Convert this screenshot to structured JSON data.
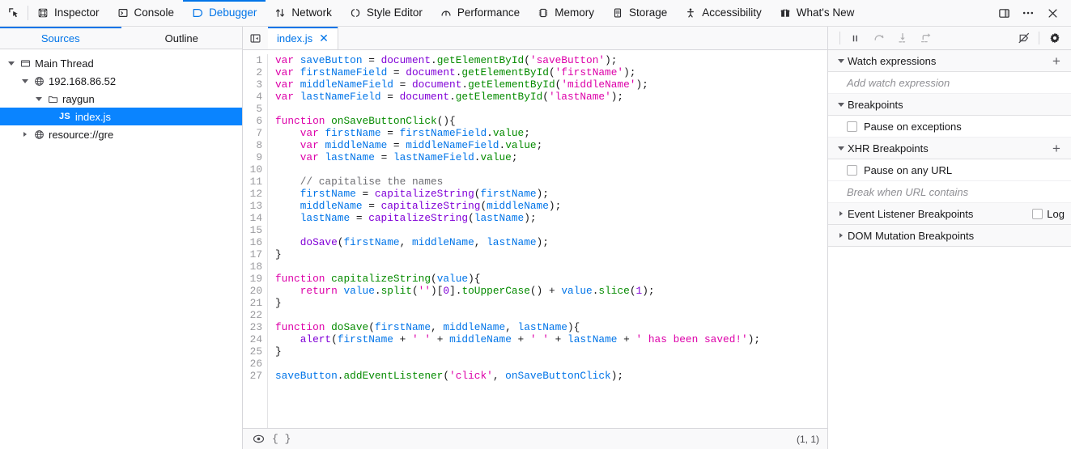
{
  "toolbar": {
    "picker_icon": "element-picker-icon",
    "tabs": [
      {
        "label": "Inspector",
        "icon": "inspector-icon",
        "active": false
      },
      {
        "label": "Console",
        "icon": "console-icon",
        "active": false
      },
      {
        "label": "Debugger",
        "icon": "debugger-icon",
        "active": true
      },
      {
        "label": "Network",
        "icon": "network-icon",
        "active": false
      },
      {
        "label": "Style Editor",
        "icon": "style-editor-icon",
        "active": false
      },
      {
        "label": "Performance",
        "icon": "performance-icon",
        "active": false
      },
      {
        "label": "Memory",
        "icon": "memory-icon",
        "active": false
      },
      {
        "label": "Storage",
        "icon": "storage-icon",
        "active": false
      },
      {
        "label": "Accessibility",
        "icon": "accessibility-icon",
        "active": false
      },
      {
        "label": "What's New",
        "icon": "whats-new-gift-icon",
        "active": false
      }
    ],
    "right_buttons": [
      {
        "name": "dock-to-side-icon"
      },
      {
        "name": "meatball-menu-icon"
      },
      {
        "name": "close-devtools-icon"
      }
    ],
    "accent_color": "#0074e8",
    "background": "#f9f9fa"
  },
  "sources": {
    "tabs": [
      {
        "label": "Sources",
        "active": true
      },
      {
        "label": "Outline",
        "active": false
      }
    ],
    "tree": [
      {
        "label": "Main Thread",
        "icon": "thread-icon",
        "depth": 0,
        "twisty": "open",
        "selected": false
      },
      {
        "label": "192.168.86.52",
        "icon": "globe-icon",
        "depth": 1,
        "twisty": "open",
        "selected": false
      },
      {
        "label": "raygun",
        "icon": "folder-icon",
        "depth": 2,
        "twisty": "open",
        "selected": false
      },
      {
        "label": "index.js",
        "icon": "js-file-icon",
        "depth": 3,
        "twisty": "none",
        "selected": true,
        "badge": "JS"
      },
      {
        "label": "resource://gre",
        "icon": "globe-icon",
        "depth": 1,
        "twisty": "closed",
        "selected": false
      }
    ],
    "selected_color": "#0a84ff"
  },
  "editor": {
    "tabbar_button": "show-sources-pane-icon",
    "file_tab": {
      "label": "index.js",
      "close_label": "✕",
      "active": true
    },
    "cursor_position": "(1, 1)",
    "prettyprint_label": "{ }",
    "eye_icon": "watch-source-icon",
    "lines": [
      {
        "n": 1,
        "tokens": [
          {
            "t": "var",
            "c": "t-kw"
          },
          {
            "t": " "
          },
          {
            "t": "saveButton",
            "c": "t-var"
          },
          {
            "t": " = "
          },
          {
            "t": "document",
            "c": "t-obj"
          },
          {
            "t": "."
          },
          {
            "t": "getElementById",
            "c": "t-prop"
          },
          {
            "t": "("
          },
          {
            "t": "'saveButton'",
            "c": "t-str"
          },
          {
            "t": ");"
          }
        ]
      },
      {
        "n": 2,
        "tokens": [
          {
            "t": "var",
            "c": "t-kw"
          },
          {
            "t": " "
          },
          {
            "t": "firstNameField",
            "c": "t-var"
          },
          {
            "t": " = "
          },
          {
            "t": "document",
            "c": "t-obj"
          },
          {
            "t": "."
          },
          {
            "t": "getElementById",
            "c": "t-prop"
          },
          {
            "t": "("
          },
          {
            "t": "'firstName'",
            "c": "t-str"
          },
          {
            "t": ");"
          }
        ]
      },
      {
        "n": 3,
        "tokens": [
          {
            "t": "var",
            "c": "t-kw"
          },
          {
            "t": " "
          },
          {
            "t": "middleNameField",
            "c": "t-var"
          },
          {
            "t": " = "
          },
          {
            "t": "document",
            "c": "t-obj"
          },
          {
            "t": "."
          },
          {
            "t": "getElementById",
            "c": "t-prop"
          },
          {
            "t": "("
          },
          {
            "t": "'middleName'",
            "c": "t-str"
          },
          {
            "t": ");"
          }
        ]
      },
      {
        "n": 4,
        "tokens": [
          {
            "t": "var",
            "c": "t-kw"
          },
          {
            "t": " "
          },
          {
            "t": "lastNameField",
            "c": "t-var"
          },
          {
            "t": " = "
          },
          {
            "t": "document",
            "c": "t-obj"
          },
          {
            "t": "."
          },
          {
            "t": "getElementById",
            "c": "t-prop"
          },
          {
            "t": "("
          },
          {
            "t": "'lastName'",
            "c": "t-str"
          },
          {
            "t": ");"
          }
        ]
      },
      {
        "n": 5,
        "tokens": []
      },
      {
        "n": 6,
        "tokens": [
          {
            "t": "function",
            "c": "t-kw"
          },
          {
            "t": " "
          },
          {
            "t": "onSaveButtonClick",
            "c": "t-prop"
          },
          {
            "t": "(){"
          }
        ]
      },
      {
        "n": 7,
        "tokens": [
          {
            "t": "    "
          },
          {
            "t": "var",
            "c": "t-kw"
          },
          {
            "t": " "
          },
          {
            "t": "firstName",
            "c": "t-var"
          },
          {
            "t": " = "
          },
          {
            "t": "firstNameField",
            "c": "t-var"
          },
          {
            "t": "."
          },
          {
            "t": "value",
            "c": "t-prop"
          },
          {
            "t": ";"
          }
        ]
      },
      {
        "n": 8,
        "tokens": [
          {
            "t": "    "
          },
          {
            "t": "var",
            "c": "t-kw"
          },
          {
            "t": " "
          },
          {
            "t": "middleName",
            "c": "t-var"
          },
          {
            "t": " = "
          },
          {
            "t": "middleNameField",
            "c": "t-var"
          },
          {
            "t": "."
          },
          {
            "t": "value",
            "c": "t-prop"
          },
          {
            "t": ";"
          }
        ]
      },
      {
        "n": 9,
        "tokens": [
          {
            "t": "    "
          },
          {
            "t": "var",
            "c": "t-kw"
          },
          {
            "t": " "
          },
          {
            "t": "lastName",
            "c": "t-var"
          },
          {
            "t": " = "
          },
          {
            "t": "lastNameField",
            "c": "t-var"
          },
          {
            "t": "."
          },
          {
            "t": "value",
            "c": "t-prop"
          },
          {
            "t": ";"
          }
        ]
      },
      {
        "n": 10,
        "tokens": []
      },
      {
        "n": 11,
        "tokens": [
          {
            "t": "    "
          },
          {
            "t": "// capitalise the names",
            "c": "t-cmt"
          }
        ]
      },
      {
        "n": 12,
        "tokens": [
          {
            "t": "    "
          },
          {
            "t": "firstName",
            "c": "t-var"
          },
          {
            "t": " = "
          },
          {
            "t": "capitalizeString",
            "c": "t-obj"
          },
          {
            "t": "("
          },
          {
            "t": "firstName",
            "c": "t-var"
          },
          {
            "t": ");"
          }
        ]
      },
      {
        "n": 13,
        "tokens": [
          {
            "t": "    "
          },
          {
            "t": "middleName",
            "c": "t-var"
          },
          {
            "t": " = "
          },
          {
            "t": "capitalizeString",
            "c": "t-obj"
          },
          {
            "t": "("
          },
          {
            "t": "middleName",
            "c": "t-var"
          },
          {
            "t": ");"
          }
        ]
      },
      {
        "n": 14,
        "tokens": [
          {
            "t": "    "
          },
          {
            "t": "lastName",
            "c": "t-var"
          },
          {
            "t": " = "
          },
          {
            "t": "capitalizeString",
            "c": "t-obj"
          },
          {
            "t": "("
          },
          {
            "t": "lastName",
            "c": "t-var"
          },
          {
            "t": ");"
          }
        ]
      },
      {
        "n": 15,
        "tokens": []
      },
      {
        "n": 16,
        "tokens": [
          {
            "t": "    "
          },
          {
            "t": "doSave",
            "c": "t-obj"
          },
          {
            "t": "("
          },
          {
            "t": "firstName",
            "c": "t-var"
          },
          {
            "t": ", "
          },
          {
            "t": "middleName",
            "c": "t-var"
          },
          {
            "t": ", "
          },
          {
            "t": "lastName",
            "c": "t-var"
          },
          {
            "t": ");"
          }
        ]
      },
      {
        "n": 17,
        "tokens": [
          {
            "t": "}"
          }
        ]
      },
      {
        "n": 18,
        "tokens": []
      },
      {
        "n": 19,
        "tokens": [
          {
            "t": "function",
            "c": "t-kw"
          },
          {
            "t": " "
          },
          {
            "t": "capitalizeString",
            "c": "t-prop"
          },
          {
            "t": "("
          },
          {
            "t": "value",
            "c": "t-var"
          },
          {
            "t": "){"
          }
        ]
      },
      {
        "n": 20,
        "tokens": [
          {
            "t": "    "
          },
          {
            "t": "return",
            "c": "t-kw"
          },
          {
            "t": " "
          },
          {
            "t": "value",
            "c": "t-var"
          },
          {
            "t": "."
          },
          {
            "t": "split",
            "c": "t-prop"
          },
          {
            "t": "("
          },
          {
            "t": "''",
            "c": "t-str"
          },
          {
            "t": ")["
          },
          {
            "t": "0",
            "c": "t-obj"
          },
          {
            "t": "]."
          },
          {
            "t": "toUpperCase",
            "c": "t-prop"
          },
          {
            "t": "() + "
          },
          {
            "t": "value",
            "c": "t-var"
          },
          {
            "t": "."
          },
          {
            "t": "slice",
            "c": "t-prop"
          },
          {
            "t": "("
          },
          {
            "t": "1",
            "c": "t-obj"
          },
          {
            "t": ");"
          }
        ]
      },
      {
        "n": 21,
        "tokens": [
          {
            "t": "}"
          }
        ]
      },
      {
        "n": 22,
        "tokens": []
      },
      {
        "n": 23,
        "tokens": [
          {
            "t": "function",
            "c": "t-kw"
          },
          {
            "t": " "
          },
          {
            "t": "doSave",
            "c": "t-prop"
          },
          {
            "t": "("
          },
          {
            "t": "firstName",
            "c": "t-var"
          },
          {
            "t": ", "
          },
          {
            "t": "middleName",
            "c": "t-var"
          },
          {
            "t": ", "
          },
          {
            "t": "lastName",
            "c": "t-var"
          },
          {
            "t": "){"
          }
        ]
      },
      {
        "n": 24,
        "tokens": [
          {
            "t": "    "
          },
          {
            "t": "alert",
            "c": "t-obj"
          },
          {
            "t": "("
          },
          {
            "t": "firstName",
            "c": "t-var"
          },
          {
            "t": " + "
          },
          {
            "t": "' '",
            "c": "t-str"
          },
          {
            "t": " + "
          },
          {
            "t": "middleName",
            "c": "t-var"
          },
          {
            "t": " + "
          },
          {
            "t": "' '",
            "c": "t-str"
          },
          {
            "t": " + "
          },
          {
            "t": "lastName",
            "c": "t-var"
          },
          {
            "t": " + "
          },
          {
            "t": "' has been saved!'",
            "c": "t-str"
          },
          {
            "t": ");"
          }
        ]
      },
      {
        "n": 25,
        "tokens": [
          {
            "t": "}"
          }
        ]
      },
      {
        "n": 26,
        "tokens": []
      },
      {
        "n": 27,
        "tokens": [
          {
            "t": "saveButton",
            "c": "t-var"
          },
          {
            "t": "."
          },
          {
            "t": "addEventListener",
            "c": "t-prop"
          },
          {
            "t": "("
          },
          {
            "t": "'click'",
            "c": "t-str"
          },
          {
            "t": ", "
          },
          {
            "t": "onSaveButtonClick",
            "c": "t-var"
          },
          {
            "t": ");"
          }
        ]
      }
    ]
  },
  "debugger_controls": [
    {
      "name": "resume-pause-button",
      "icon": "pause-icon"
    },
    {
      "name": "step-over-button",
      "icon": "step-over-icon"
    },
    {
      "name": "step-in-button",
      "icon": "step-in-icon"
    },
    {
      "name": "step-out-button",
      "icon": "step-out-icon"
    },
    {
      "name": "deactivate-breakpoints-button",
      "icon": "breakpoints-disabled-icon"
    },
    {
      "name": "debugger-settings-button",
      "icon": "gear-icon"
    }
  ],
  "panels": {
    "watch_expressions": {
      "title": "Watch expressions",
      "add_label": "+",
      "placeholder": "Add watch expression",
      "expanded": true
    },
    "breakpoints": {
      "title": "Breakpoints",
      "expanded": true,
      "pause_on_exceptions": {
        "label": "Pause on exceptions",
        "checked": false
      }
    },
    "xhr_breakpoints": {
      "title": "XHR Breakpoints",
      "add_label": "+",
      "expanded": true,
      "pause_on_any_url": {
        "label": "Pause on any URL",
        "checked": false
      },
      "placeholder": "Break when URL contains"
    },
    "event_listener_breakpoints": {
      "title": "Event Listener Breakpoints",
      "expanded": false,
      "log_label": "Log",
      "log_checked": false
    },
    "dom_mutation_breakpoints": {
      "title": "DOM Mutation Breakpoints",
      "expanded": false
    }
  }
}
